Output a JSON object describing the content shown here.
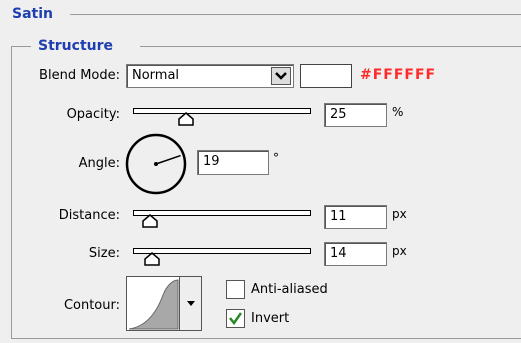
{
  "satin": {
    "title": "Satin"
  },
  "structure": {
    "title": "Structure"
  },
  "blend_mode": {
    "label": "Blend Mode:",
    "value": "Normal",
    "color_code": "#FFFFFF",
    "swatch_color": "#ffffff",
    "code_color": "#ff2a2a"
  },
  "opacity": {
    "label": "Opacity:",
    "value": "25",
    "unit": "%",
    "level": 0.25
  },
  "angle": {
    "label": "Angle:",
    "value": "19",
    "unit": "°",
    "degrees": 19
  },
  "distance": {
    "label": "Distance:",
    "value": "11",
    "unit": "px",
    "level": 0.04
  },
  "size": {
    "label": "Size:",
    "value": "14",
    "unit": "px",
    "level": 0.05
  },
  "contour": {
    "label": "Contour:"
  },
  "anti_aliased": {
    "label": "Anti-aliased",
    "checked": false
  },
  "invert": {
    "label": "Invert",
    "checked": true
  },
  "colors": {
    "accent": "#1f3fb0",
    "check": "#2a8a2a"
  }
}
